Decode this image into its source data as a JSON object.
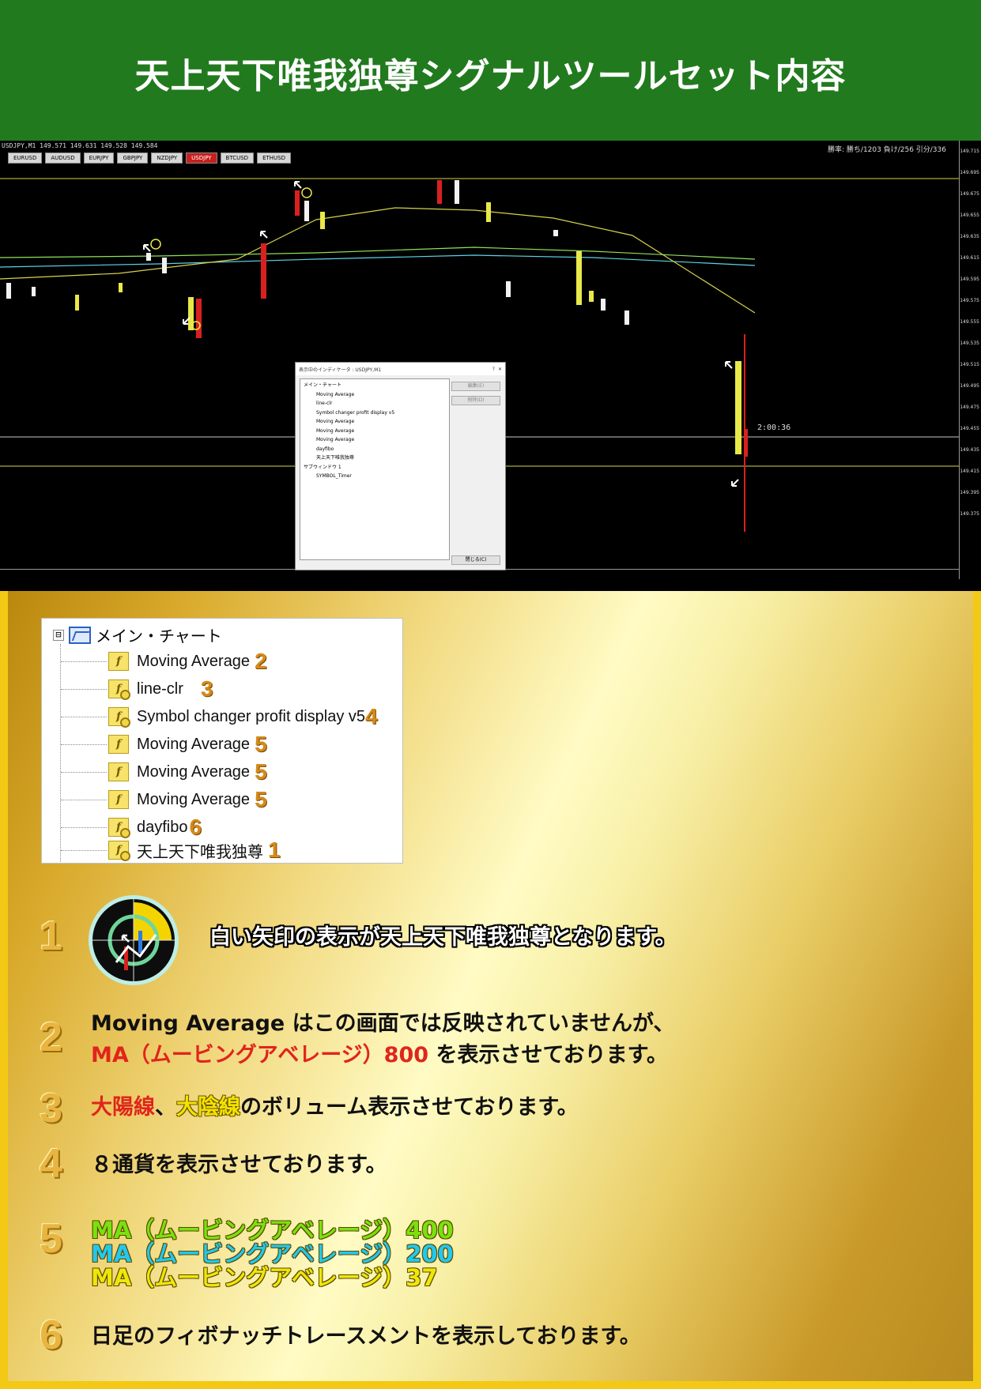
{
  "header": {
    "title": "天上天下唯我独尊シグナルツールセット内容"
  },
  "chart": {
    "symbol_info": "USDJPY,M1  149.571 149.631 149.528 149.584",
    "tabs": [
      "EURUSD",
      "AUDUSD",
      "EURJPY",
      "GBPJPY",
      "NZDJPY",
      "USDJPY",
      "BTCUSD",
      "ETHUSD"
    ],
    "active_tab": "USDJPY",
    "stats": "勝率: 勝ち/1203 負け/256 引分/336",
    "timer": "2:00:36",
    "price_labels": [
      "149.715",
      "149.695",
      "149.675",
      "149.655",
      "149.635",
      "149.615",
      "149.595",
      "149.575",
      "149.555",
      "149.535",
      "149.515",
      "149.495",
      "149.475",
      "149.455",
      "149.435",
      "149.415",
      "149.395",
      "149.375"
    ],
    "dialog": {
      "title": "表示中のインディケータ : USDJPY,M1",
      "help": "?",
      "close": "✕",
      "root": "メイン・チャート",
      "items": [
        "Moving Average",
        "line-clr",
        "Symbol changer profit display v5",
        "Moving Average",
        "Moving Average",
        "Moving Average",
        "dayfibo",
        "天上天下唯我独尊"
      ],
      "subwindow": "サブウィンドウ 1",
      "sub_item": "SYMBOL_Timer",
      "btn_edit": "編集(E)",
      "btn_delete": "削除(D)",
      "btn_close": "閉じる(C)"
    }
  },
  "panel": {
    "root": "メイン・チャート",
    "expander": "⊟",
    "items": [
      {
        "label": "Moving Average",
        "badge": "2"
      },
      {
        "label": "line-clr",
        "badge": "3"
      },
      {
        "label": "Symbol changer profit display v5",
        "badge": "4"
      },
      {
        "label": "Moving Average",
        "badge": "5"
      },
      {
        "label": "Moving Average",
        "badge": "5"
      },
      {
        "label": "Moving Average",
        "badge": "5"
      },
      {
        "label": "dayfibo",
        "badge": "6"
      },
      {
        "label": "天上天下唯我独尊",
        "badge": "1"
      }
    ]
  },
  "notes": {
    "n1": {
      "num": "1",
      "text": "白い矢印の表示が天上天下唯我独尊となります。"
    },
    "n2": {
      "num": "2",
      "line1": "Moving Average はこの画面では反映されていませんが、",
      "line2_red": "MA（ムービングアベレージ）800",
      "line2_rest": " を表示させております。"
    },
    "n3": {
      "num": "3",
      "red": "大陽線",
      "sep": "、",
      "yellow": "大陰線",
      "rest": "のボリューム表示させております。"
    },
    "n4": {
      "num": "4",
      "text": "８通貨を表示させております。"
    },
    "n5": {
      "num": "5",
      "ma400": "MA（ムービングアベレージ）400",
      "ma200": "MA（ムービングアベレージ）200",
      "ma37": "MA（ムービングアベレージ）37"
    },
    "n6": {
      "num": "6",
      "text": "日足のフィボナッチトレースメントを表示しております。"
    }
  },
  "colors": {
    "header_bg": "#227a1f",
    "gold_frame": "#f3c915",
    "red": "#e0251c",
    "ma400": "#79e20e",
    "ma200": "#21c9ef",
    "ma37": "#efe60a"
  }
}
